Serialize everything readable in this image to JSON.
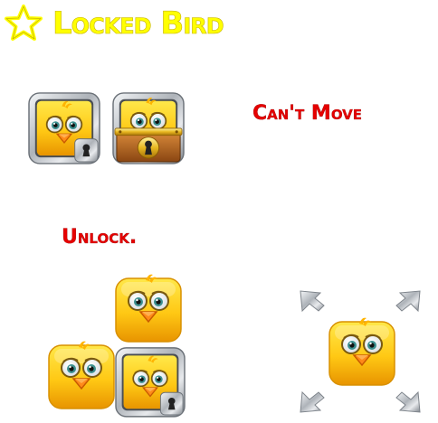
{
  "header": {
    "title": "Locked Bird",
    "icon": "star-outline-icon"
  },
  "notes": {
    "cant_move": "Can't Move",
    "unlock": "Unlock."
  },
  "colors": {
    "title_yellow": "#ffff00",
    "note_red": "#e60000",
    "bird_yellow": "#ffcf10",
    "beak_orange": "#ff8a1a",
    "metal": "#c9cdd2",
    "wood": "#b8651c",
    "gold": "#e8b820"
  },
  "sprites": [
    {
      "name": "bird-in-metal-lock-frame",
      "icon": "lock-icon"
    },
    {
      "name": "bird-in-wooden-chest",
      "icon": "keyhole-icon"
    },
    {
      "name": "bird-block",
      "icon": "bird-icon"
    },
    {
      "name": "bird-block",
      "icon": "bird-icon"
    },
    {
      "name": "bird-in-metal-lock-frame",
      "icon": "lock-icon"
    },
    {
      "name": "bird-block-with-corner-arrows",
      "icon": "corner-arrows-icon"
    }
  ]
}
